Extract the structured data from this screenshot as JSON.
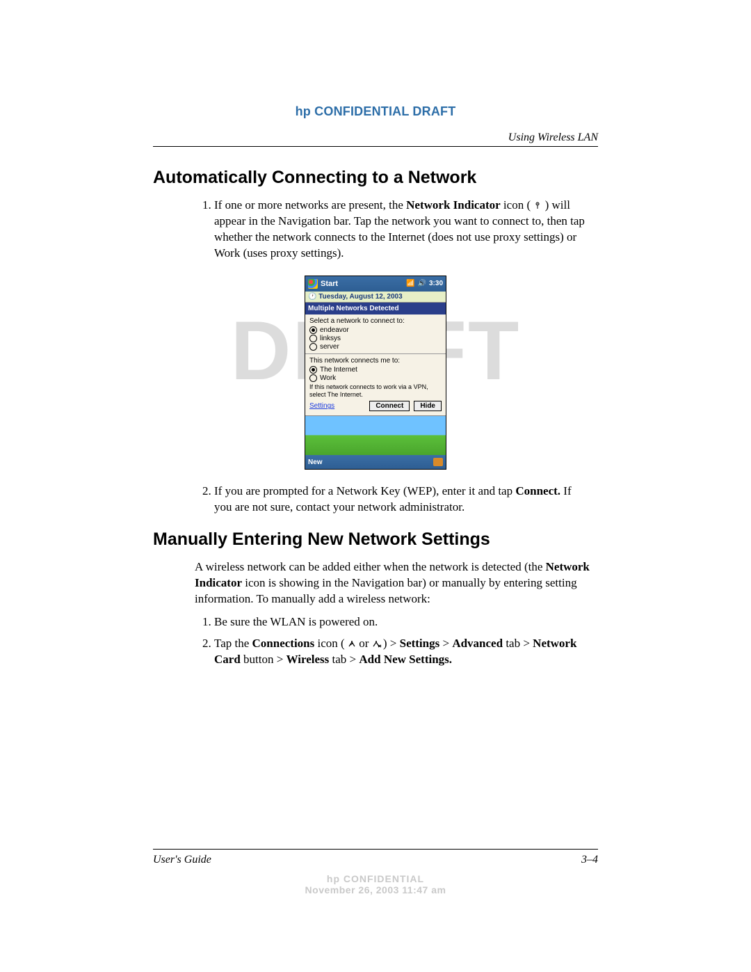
{
  "header": {
    "confidential": "hp CONFIDENTIAL DRAFT",
    "section_name": "Using Wireless LAN"
  },
  "watermark": "DRAFT",
  "section1": {
    "title": "Automatically Connecting to a Network",
    "step1_a": "If one or more networks are present, the ",
    "step1_b": "Network Indicator",
    "step1_c": " icon ( ",
    "step1_d": " ) will appear in the Navigation bar. Tap the network you want to connect to, then tap whether the network connects to the Internet (does not use proxy settings) or Work (uses proxy settings).",
    "step2_a": "If you are prompted for a Network Key (WEP), enter it and tap ",
    "step2_b": "Connect.",
    "step2_c": " If you are not sure, contact your network administrator."
  },
  "pda": {
    "start": "Start",
    "time": "3:30",
    "date": "Tuesday, August 12, 2003",
    "banner": "Multiple Networks Detected",
    "select_label": "Select a network to connect to:",
    "net1": "endeavor",
    "net2": "linksys",
    "net3": "server",
    "connects_label": "This network connects me to:",
    "opt_internet": "The Internet",
    "opt_work": "Work",
    "vpn_note": "If this network connects to work via a VPN, select The Internet.",
    "settings_link": "Settings",
    "connect_btn": "Connect",
    "hide_btn": "Hide",
    "new_label": "New"
  },
  "section2": {
    "title": "Manually Entering New Network Settings",
    "intro_a": "A wireless network can be added either when the network is detected (the ",
    "intro_b": "Network Indicator",
    "intro_c": " icon is showing in the Navigation bar) or manually by entering setting information. To manually add a wireless network:",
    "step1": "Be sure the WLAN is powered on.",
    "step2_a": "Tap the ",
    "step2_b": "Connections",
    "step2_c": " icon ( ",
    "step2_d": "  or  ",
    "step2_e": " ) > ",
    "step2_f": "Settings",
    "step2_g": " > ",
    "step2_h": "Advanced",
    "step2_i": " tab > ",
    "step2_j": "Network Card",
    "step2_k": " button > ",
    "step2_l": "Wireless",
    "step2_m": " tab > ",
    "step2_n": "Add New Settings."
  },
  "footer": {
    "guide": "User's Guide",
    "page": "3–4",
    "conf": "hp CONFIDENTIAL",
    "timestamp": "November 26, 2003 11:47 am"
  }
}
